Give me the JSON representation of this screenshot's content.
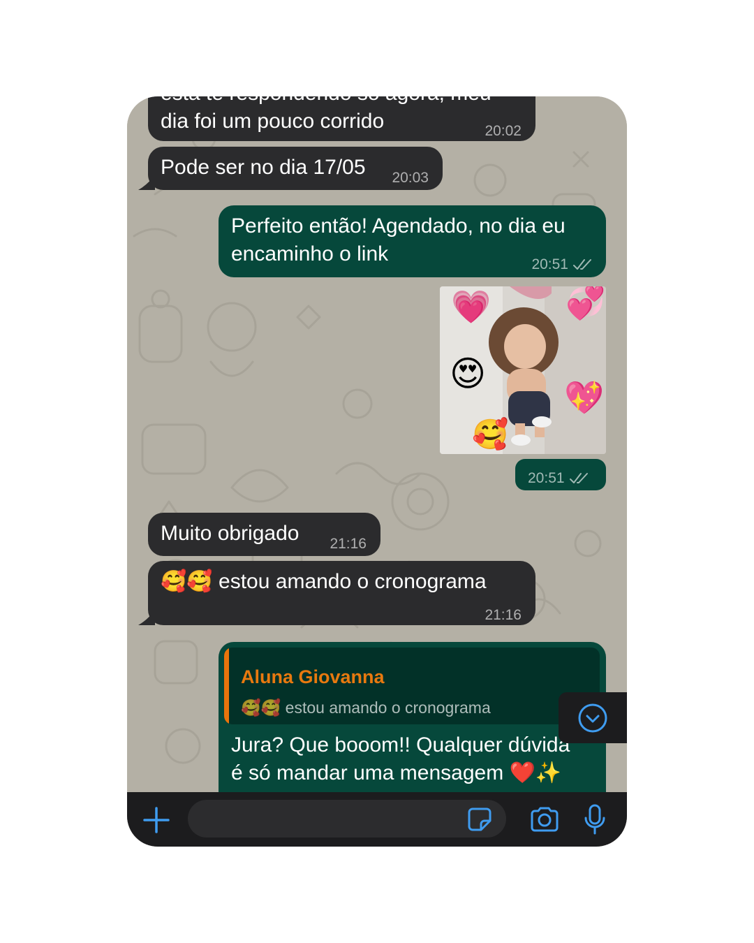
{
  "messages": [
    {
      "direction": "incoming",
      "lines": [
        "está te respondendo só agora, meu",
        "dia foi um pouco corrido"
      ],
      "time": "20:02"
    },
    {
      "direction": "incoming",
      "lines": [
        "Pode ser no dia 17/05"
      ],
      "time": "20:03"
    },
    {
      "direction": "outgoing",
      "lines": [
        "Perfeito então! Agendado, no dia eu",
        "encaminho o link"
      ],
      "time": "20:51",
      "read": true
    },
    {
      "direction": "outgoing",
      "type": "image",
      "time": "20:51",
      "read": true
    },
    {
      "direction": "incoming",
      "lines": [
        "Muito obrigado"
      ],
      "time": "21:16"
    },
    {
      "direction": "incoming",
      "lines": [
        "🥰🥰 estou amando o cronograma"
      ],
      "time": "21:16"
    },
    {
      "direction": "outgoing",
      "reply_to": {
        "name": "Aluna Giovanna",
        "text": "🥰🥰 estou amando o cronograma"
      },
      "lines": [
        "Jura? Que booom!! Qualquer dúvida",
        "é só mandar uma mensagem ❤️✨"
      ]
    }
  ],
  "photo_stickers": [
    "💗",
    "💞",
    "😍",
    "💖",
    "🥰"
  ],
  "icons": {
    "plus": "plus-icon",
    "sticker": "sticker-icon",
    "camera": "camera-icon",
    "mic": "microphone-icon",
    "scroll_down": "chevron-down-circle-icon",
    "read_receipt": "double-check-icon"
  },
  "colors": {
    "incoming_bubble": "#2b2b2d",
    "outgoing_bubble": "#06483b",
    "reply_name": "#e8790f",
    "accent_blue": "#3f9cf0",
    "wallpaper": "#b4b0a5"
  }
}
